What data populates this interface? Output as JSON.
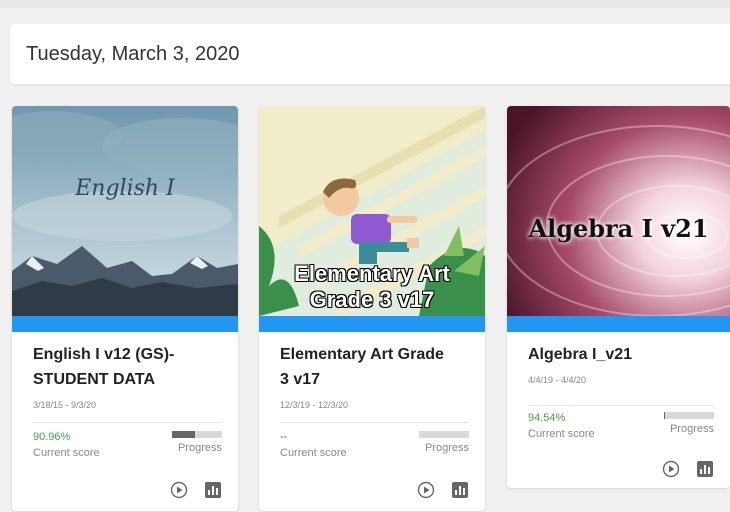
{
  "header": {
    "date": "Tuesday, March 3, 2020"
  },
  "cards": [
    {
      "image_text": "English I",
      "title_line1": "English I v12 (GS)-",
      "title_line2": "STUDENT DATA",
      "dates": "3/18/15 - 9/3/20",
      "score": "90.96%",
      "score_label": "Current score",
      "progress_label": "Progress",
      "progress": 0.45
    },
    {
      "image_text_line1": "Elementary Art",
      "image_text_line2": "Grade 3 v17",
      "title_line1": "Elementary Art Grade",
      "title_line2": "3 v17",
      "dates": "12/3/19 - 12/3/20",
      "score": "--",
      "score_label": "Current score",
      "progress_label": "Progress",
      "progress": 0.0
    },
    {
      "image_text": "Algebra I v21",
      "title_line1": "Algebra I_v21",
      "dates": "4/4/19 - 4/4/20",
      "score": "94.54%",
      "score_label": "Current score",
      "progress_label": "Progress",
      "progress": 0.02
    }
  ],
  "icons": {
    "play": "play-circle-icon",
    "chart": "bar-chart-icon"
  },
  "colors": {
    "accent": "#2196f3",
    "score_green": "#43a047"
  }
}
